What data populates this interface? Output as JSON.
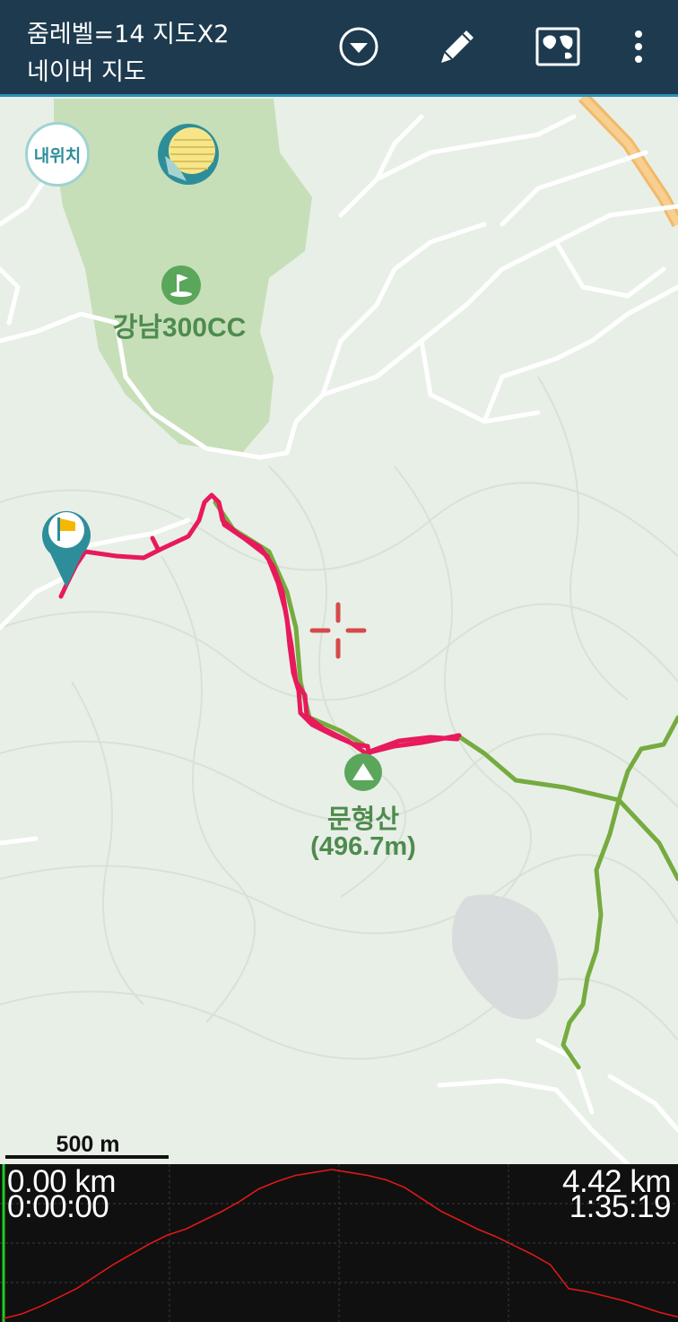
{
  "header": {
    "zoom_title": "줌레벨=14 지도X2",
    "map_source": "네이버 지도",
    "icons": [
      "dropdown-icon",
      "pencil-icon",
      "map-icon",
      "more-vert-icon"
    ]
  },
  "map": {
    "my_location_label": "내위치",
    "golf_course_label": "강남300CC",
    "peak_name": "문형산",
    "peak_elevation": "(496.7m)",
    "scale_label": "500 m",
    "colors": {
      "track": "#e8195c",
      "trail": "#76ab3f",
      "park": "#c6dfb8",
      "road_major": "#f2b96a"
    }
  },
  "profile": {
    "start_distance": "0.00 km",
    "start_time": "0:00:00",
    "end_distance": "4.42 km",
    "end_time": "1:35:19",
    "line_color": "#e01818",
    "elevation_profile": [
      0.0,
      0.03,
      0.08,
      0.14,
      0.2,
      0.28,
      0.36,
      0.43,
      0.5,
      0.56,
      0.6,
      0.66,
      0.72,
      0.79,
      0.87,
      0.92,
      0.96,
      0.98,
      1.0,
      0.98,
      0.96,
      0.93,
      0.88,
      0.8,
      0.72,
      0.66,
      0.6,
      0.55,
      0.49,
      0.43,
      0.36,
      0.2,
      0.18,
      0.15,
      0.12,
      0.08,
      0.04,
      0.01
    ]
  }
}
